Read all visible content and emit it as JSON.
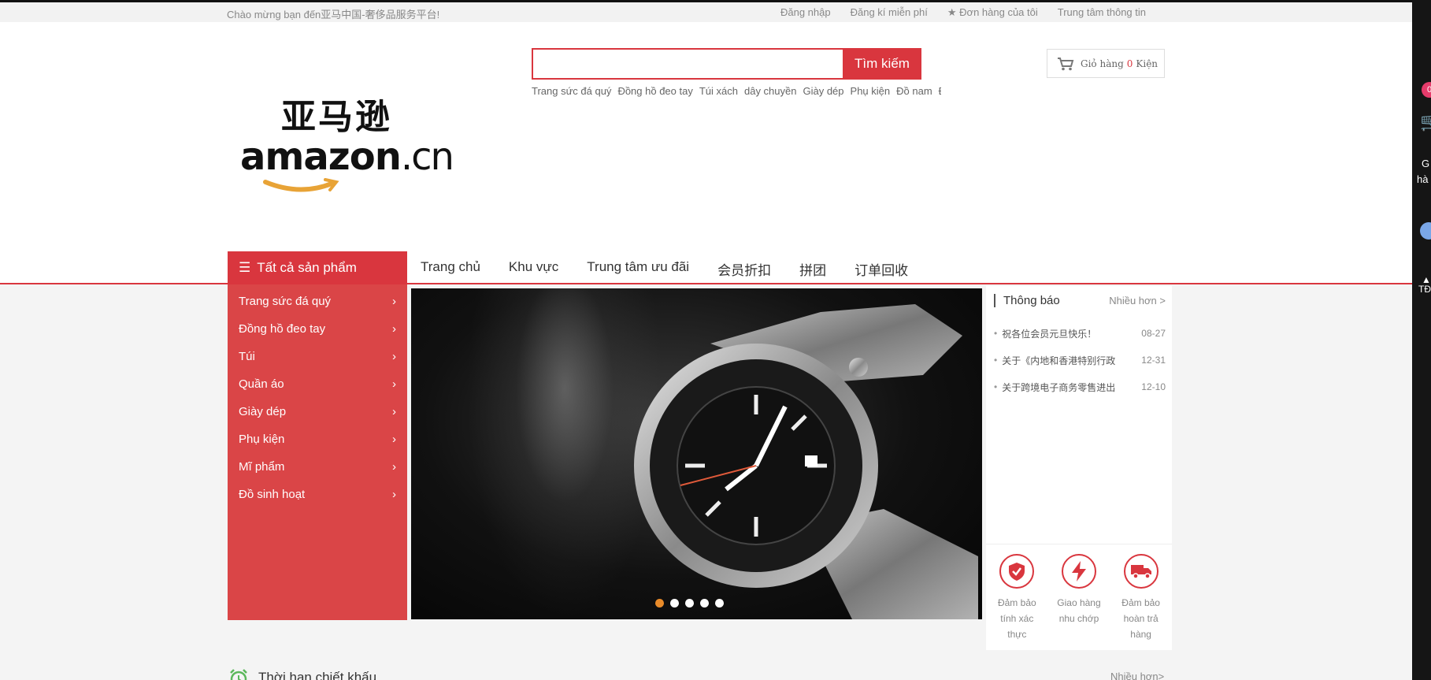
{
  "topbar": {
    "welcome": "Chào mừng bạn đến亚马中国-奢侈品服务平台!",
    "links": [
      "Đăng nhập",
      "Đăng kí miễn phí",
      "★ Đơn hàng của tôi",
      "Trung tâm thông tin"
    ]
  },
  "logo": {
    "cn": "亚马逊",
    "en": "amazon",
    "en_suffix": ".cn"
  },
  "search": {
    "value": "",
    "button": "Tìm kiếm",
    "hotwords": [
      "Trang sức đá quý",
      "Đồng hồ đeo tay",
      "Túi xách",
      "dây chuyền",
      "Giày dép",
      "Phụ kiện",
      "Đồ nam",
      "Đồ"
    ]
  },
  "cart": {
    "label": "Giỏ hàng",
    "count": "0",
    "unit": "Kiện"
  },
  "nav": {
    "all_label": "Tất cả sản phẩm",
    "links": [
      "Trang chủ",
      "Khu vực",
      "Trung tâm ưu đãi",
      "会员折扣",
      "拼团",
      "订单回收"
    ]
  },
  "categories": [
    "Trang sức đá quý",
    "Đồng hồ đeo tay",
    "Túi",
    "Quần áo",
    "Giày dép",
    "Phụ kiện",
    "Mĩ phẩm",
    "Đồ sinh hoạt"
  ],
  "banner": {
    "slide_count": 5,
    "active_slide": 1
  },
  "notice": {
    "title": "Thông báo",
    "more": "Nhiều hơn >",
    "items": [
      {
        "text": "祝各位会员元旦快乐！",
        "date": "08-27"
      },
      {
        "text": "关于《内地和香港特别行政",
        "date": "12-31"
      },
      {
        "text": "关于跨境电子商务零售进出",
        "date": "12-10"
      }
    ]
  },
  "services": [
    {
      "icon": "shield-check-icon",
      "line1": "Đảm bảo",
      "line2": "tính xác",
      "line3": "thực"
    },
    {
      "icon": "lightning-icon",
      "line1": "Giao hàng",
      "line2": "nhu chớp",
      "line3": ""
    },
    {
      "icon": "truck-icon",
      "line1": "Đảm bảo",
      "line2": "hoàn trả",
      "line3": "hàng"
    }
  ],
  "discount_section": {
    "title": "Thời hạn chiết khấu",
    "more": "Nhiều hơn>"
  },
  "sidebar_right": {
    "badge": "0",
    "text1": "G",
    "text2": "hà",
    "text3": "TĐ"
  },
  "colors": {
    "primary": "#d9363e",
    "accent_dot": "#e98b2a"
  }
}
